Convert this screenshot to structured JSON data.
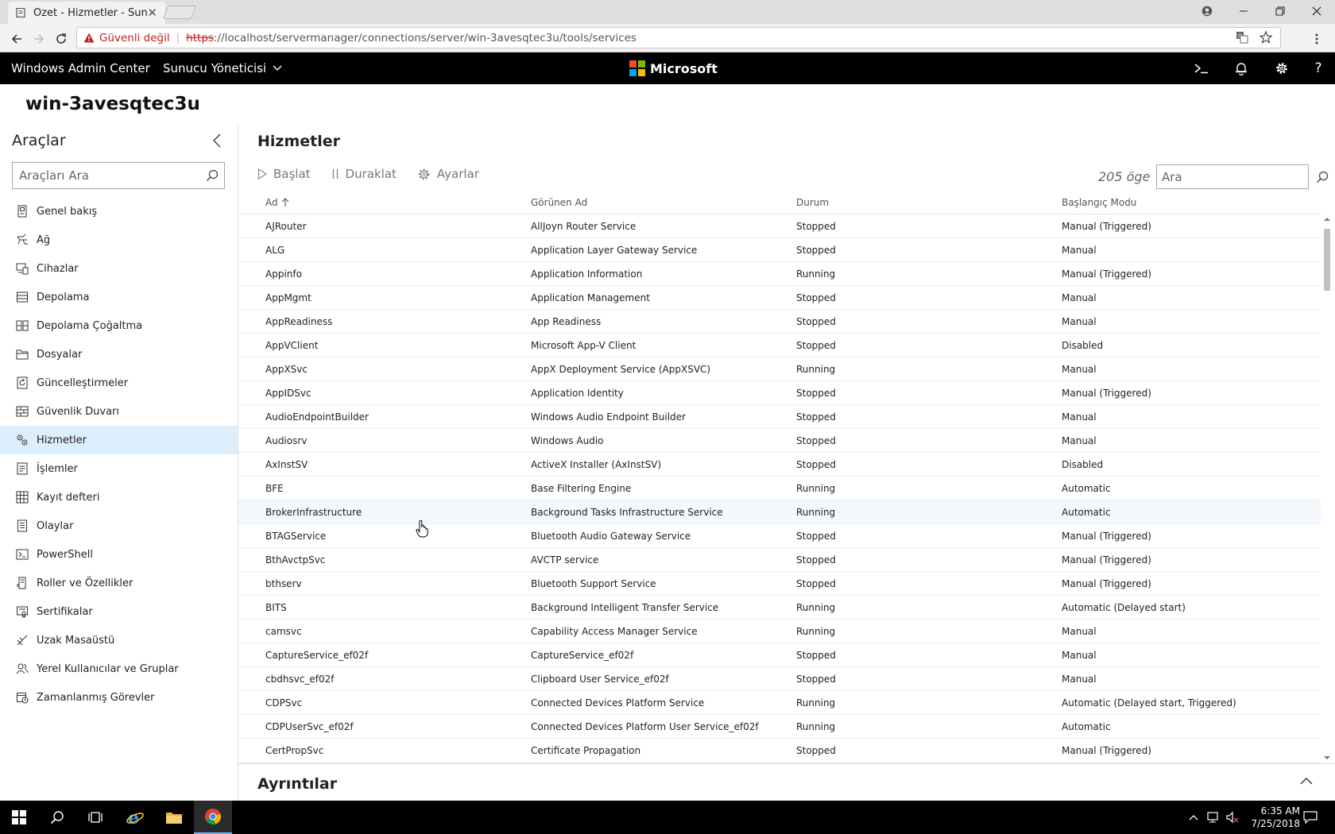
{
  "browser": {
    "tab_title": "Özet - Hizmetler - Sunucu",
    "security_label": "Güvenli değil",
    "url_scheme": "https",
    "url_rest": "://localhost/servermanager/connections/server/win-3avesqtec3u/tools/services"
  },
  "app": {
    "title": "Windows Admin Center",
    "menu_label": "Sunucu Yöneticisi",
    "brand": "Microsoft",
    "brand_colors": [
      "#f25022",
      "#7fba00",
      "#00a4ef",
      "#ffb900"
    ]
  },
  "server_name": "win-3avesqtec3u",
  "sidebar": {
    "title": "Araçlar",
    "search_placeholder": "Araçları Ara",
    "items": [
      {
        "label": "Genel bakış"
      },
      {
        "label": "Ağ"
      },
      {
        "label": "Cihazlar"
      },
      {
        "label": "Depolama"
      },
      {
        "label": "Depolama Çoğaltma"
      },
      {
        "label": "Dosyalar"
      },
      {
        "label": "Güncelleştirmeler"
      },
      {
        "label": "Güvenlik Duvarı"
      },
      {
        "label": "Hizmetler"
      },
      {
        "label": "İşlemler"
      },
      {
        "label": "Kayıt defteri"
      },
      {
        "label": "Olaylar"
      },
      {
        "label": "PowerShell"
      },
      {
        "label": "Roller ve Özellikler"
      },
      {
        "label": "Sertifikalar"
      },
      {
        "label": "Uzak Masaüstü"
      },
      {
        "label": "Yerel Kullanıcılar ve Gruplar"
      },
      {
        "label": "Zamanlanmış Görevler"
      }
    ]
  },
  "main": {
    "title": "Hizmetler",
    "toolbar": {
      "start": "Başlat",
      "pause": "Duraklat",
      "settings": "Ayarlar"
    },
    "item_count": "205 öge",
    "search_placeholder": "Ara",
    "columns": [
      "Ad",
      "Görünen Ad",
      "Durum",
      "Başlangıç Modu"
    ],
    "rows": [
      [
        "AJRouter",
        "AllJoyn Router Service",
        "Stopped",
        "Manual (Triggered)"
      ],
      [
        "ALG",
        "Application Layer Gateway Service",
        "Stopped",
        "Manual"
      ],
      [
        "Appinfo",
        "Application Information",
        "Running",
        "Manual (Triggered)"
      ],
      [
        "AppMgmt",
        "Application Management",
        "Stopped",
        "Manual"
      ],
      [
        "AppReadiness",
        "App Readiness",
        "Stopped",
        "Manual"
      ],
      [
        "AppVClient",
        "Microsoft App-V Client",
        "Stopped",
        "Disabled"
      ],
      [
        "AppXSvc",
        "AppX Deployment Service (AppXSVC)",
        "Running",
        "Manual"
      ],
      [
        "AppIDSvc",
        "Application Identity",
        "Stopped",
        "Manual (Triggered)"
      ],
      [
        "AudioEndpointBuilder",
        "Windows Audio Endpoint Builder",
        "Stopped",
        "Manual"
      ],
      [
        "Audiosrv",
        "Windows Audio",
        "Stopped",
        "Manual"
      ],
      [
        "AxInstSV",
        "ActiveX Installer (AxInstSV)",
        "Stopped",
        "Disabled"
      ],
      [
        "BFE",
        "Base Filtering Engine",
        "Running",
        "Automatic"
      ],
      [
        "BrokerInfrastructure",
        "Background Tasks Infrastructure Service",
        "Running",
        "Automatic"
      ],
      [
        "BTAGService",
        "Bluetooth Audio Gateway Service",
        "Stopped",
        "Manual (Triggered)"
      ],
      [
        "BthAvctpSvc",
        "AVCTP service",
        "Stopped",
        "Manual (Triggered)"
      ],
      [
        "bthserv",
        "Bluetooth Support Service",
        "Stopped",
        "Manual (Triggered)"
      ],
      [
        "BITS",
        "Background Intelligent Transfer Service",
        "Running",
        "Automatic (Delayed start)"
      ],
      [
        "camsvc",
        "Capability Access Manager Service",
        "Running",
        "Manual"
      ],
      [
        "CaptureService_ef02f",
        "CaptureService_ef02f",
        "Stopped",
        "Manual"
      ],
      [
        "cbdhsvc_ef02f",
        "Clipboard User Service_ef02f",
        "Stopped",
        "Manual"
      ],
      [
        "CDPSvc",
        "Connected Devices Platform Service",
        "Running",
        "Automatic (Delayed start, Triggered)"
      ],
      [
        "CDPUserSvc_ef02f",
        "Connected Devices Platform User Service_ef02f",
        "Running",
        "Automatic"
      ],
      [
        "CertPropSvc",
        "Certificate Propagation",
        "Stopped",
        "Manual (Triggered)"
      ]
    ]
  },
  "details_title": "Ayrıntılar",
  "taskbar": {
    "time": "6:35 AM",
    "date": "7/25/2018"
  }
}
